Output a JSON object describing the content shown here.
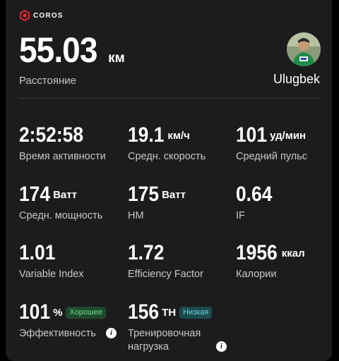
{
  "brand": {
    "name": "COROS"
  },
  "summary": {
    "distance_value": "55.03",
    "distance_unit": "км",
    "distance_label": "Расстояние",
    "username": "Ulugbek"
  },
  "metrics": [
    {
      "value": "2:52:58",
      "unit": "",
      "label": "Время активности"
    },
    {
      "value": "19.1",
      "unit": "км/ч",
      "label": "Средн. скорость"
    },
    {
      "value": "101",
      "unit": "уд/мин",
      "label": "Средний пульс"
    },
    {
      "value": "174",
      "unit": "Ватт",
      "label": "Средн. мощность"
    },
    {
      "value": "175",
      "unit": "Ватт",
      "label": "НМ"
    },
    {
      "value": "0.64",
      "unit": "",
      "label": "IF"
    },
    {
      "value": "1.01",
      "unit": "",
      "label": "Variable Index"
    },
    {
      "value": "1.72",
      "unit": "",
      "label": "Efficiency Factor"
    },
    {
      "value": "1956",
      "unit": "ккал",
      "label": "Калории"
    },
    {
      "value": "101",
      "unit": "%",
      "label": "Эффективность",
      "badge": "Хорошее",
      "info_icon": "info-icon"
    },
    {
      "value": "156",
      "unit": "TH",
      "label": "Тренировочная нагрузка",
      "badge": "Низкая",
      "info_icon": "info-icon"
    }
  ],
  "colors": {
    "card_background": "#1c1c1e",
    "badge_good_bg": "#1f4a2c",
    "badge_good_text": "#6fdc8c",
    "badge_low_bg": "#1d4a4d",
    "badge_low_text": "#6ad6dd",
    "brand_red": "#e0282e"
  }
}
